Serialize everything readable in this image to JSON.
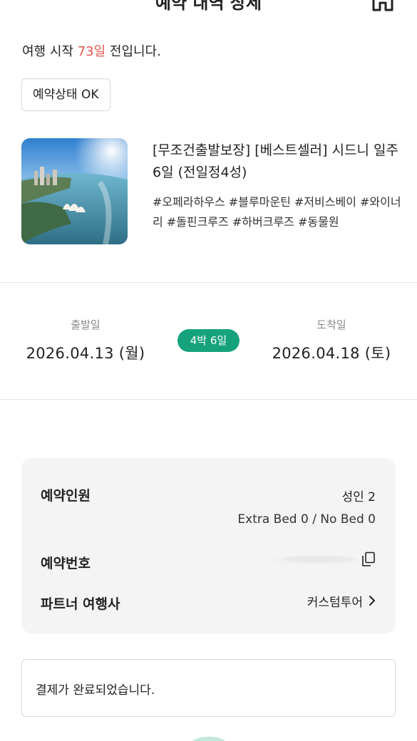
{
  "header": {
    "title": "예약 내역 상세",
    "menu_icon": "hamburger-menu-icon",
    "home_icon": "home-icon"
  },
  "countdown": {
    "prefix": "여행 시작 ",
    "days": "73일",
    "suffix": " 전입니다.",
    "days_color": "#e0574f"
  },
  "status_button": {
    "label": "예약상태 OK"
  },
  "product": {
    "image": "sydney-opera-house-photo",
    "title": "[무조건출발보장] [베스트셀러] 시드니 일주 6일 (전일정4성)",
    "tags": "#오페라하우스 #블루마운틴 #저비스베이 #와이너리 #돌핀크루즈 #하버크루즈 #동물원"
  },
  "schedule": {
    "departure_label": "출발일",
    "departure_date": "2026.04.13 (월)",
    "duration": "4박 6일",
    "arrival_label": "도착일",
    "arrival_date": "2026.04.18 (토)",
    "duration_color": "#16a37b"
  },
  "booking_info": {
    "people_label": "예약인원",
    "people_value": "성인 2",
    "bed_info": "Extra Bed 0 / No Bed 0",
    "number_label": "예약번호",
    "copy_icon": "copy-icon",
    "partner_label": "파트너 여행사",
    "partner_value": "커스텀투어"
  },
  "notice": {
    "text": "결제가 완료되었습니다."
  }
}
